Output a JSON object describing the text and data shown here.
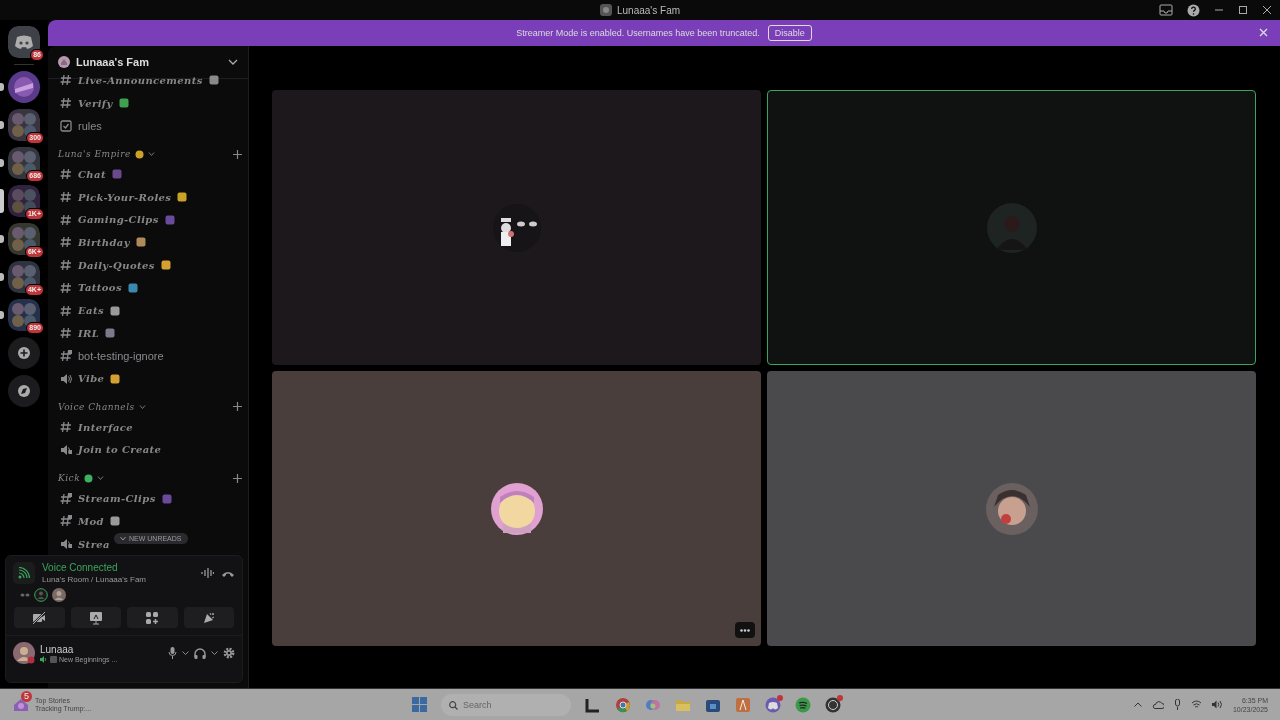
{
  "title_bar": {
    "title": "Lunaaa's Fam"
  },
  "banner": {
    "message": "Streamer Mode is enabled. Usernames have been truncated.",
    "button": "Disable"
  },
  "servers": [
    {
      "kind": "home",
      "badge": "86",
      "unread": false,
      "selected": false
    },
    {
      "kind": "server",
      "unread": true,
      "selected": false
    },
    {
      "kind": "folder",
      "badge": "300",
      "unread": true,
      "selected": false
    },
    {
      "kind": "folder",
      "badge": "686",
      "unread": true,
      "selected": false
    },
    {
      "kind": "folder",
      "badge": "1K+",
      "unread": false,
      "selected": true
    },
    {
      "kind": "folder",
      "badge": "6K+",
      "unread": true,
      "selected": false
    },
    {
      "kind": "folder",
      "badge": "4K+",
      "unread": true,
      "selected": false
    },
    {
      "kind": "folder",
      "badge": "890",
      "unread": true,
      "selected": false
    },
    {
      "kind": "add"
    },
    {
      "kind": "discover"
    }
  ],
  "guild": {
    "name": "Lunaaa's Fam"
  },
  "channels": [
    {
      "kind": "text",
      "name": "Live-Announcements",
      "fancy": true,
      "color": "#8a8a8a"
    },
    {
      "kind": "text",
      "name": "Verify",
      "fancy": true,
      "color": "#3fa050"
    },
    {
      "kind": "rules",
      "name": "rules",
      "fancy": false
    },
    {
      "kind": "category",
      "name": "Luna's Empire",
      "color": "#c9a227"
    },
    {
      "kind": "text",
      "name": "Chat",
      "fancy": true,
      "color": "#6a4a8a"
    },
    {
      "kind": "text",
      "name": "Pick-Your-Roles",
      "fancy": true,
      "color": "#c9a227"
    },
    {
      "kind": "text",
      "name": "Gaming-Clips",
      "fancy": true,
      "color": "#6a4a9a"
    },
    {
      "kind": "text",
      "name": "Birthday",
      "fancy": true,
      "color": "#b08a5a"
    },
    {
      "kind": "text",
      "name": "Daily-Quotes",
      "fancy": true,
      "color": "#d4a030"
    },
    {
      "kind": "text",
      "name": "Tattoos",
      "fancy": true,
      "color": "#3a8ab0"
    },
    {
      "kind": "text",
      "name": "Eats",
      "fancy": true,
      "color": "#9a9a9a"
    },
    {
      "kind": "text",
      "name": "IRL",
      "fancy": true,
      "color": "#7a7a8a"
    },
    {
      "kind": "locked",
      "name": "bot-testing-ignore",
      "fancy": false
    },
    {
      "kind": "voice",
      "name": "Vibe",
      "fancy": true,
      "color": "#d4a030"
    },
    {
      "kind": "category",
      "name": "Voice Channels"
    },
    {
      "kind": "text",
      "name": "Interface",
      "fancy": true
    },
    {
      "kind": "lockedvoice",
      "name": "Join to Create",
      "fancy": true
    },
    {
      "kind": "category",
      "name": "Kick",
      "color": "#3fb060"
    },
    {
      "kind": "locked",
      "name": "Stream-Clips",
      "fancy": true,
      "color": "#6a4a9a"
    },
    {
      "kind": "locked",
      "name": "Mod",
      "fancy": true,
      "color": "#9a9a9a"
    },
    {
      "kind": "lockedvoice",
      "name": "Strea",
      "fancy": true
    }
  ],
  "new_unreads": "NEW UNREADS",
  "voice": {
    "status": "Voice Connected",
    "location": "Luna's Room / Lunaaa's Fam"
  },
  "user": {
    "name": "Lunaaa",
    "activity": "New Beginnings ..."
  },
  "tiles": [
    {
      "color": "#1c181c",
      "speaking": false,
      "more": false
    },
    {
      "color": "#101212",
      "speaking": true,
      "more": false
    },
    {
      "color": "#4a3e3c",
      "speaking": false,
      "more": true
    },
    {
      "color": "#4a4a4c",
      "speaking": false,
      "more": false
    }
  ],
  "taskbar": {
    "news_title": "Top Stories",
    "news_text": "Tracking Trump:...",
    "news_badge": "5",
    "search": {
      "placeholder": "Search"
    },
    "time": "6:35 PM",
    "date": "10/23/2025"
  }
}
